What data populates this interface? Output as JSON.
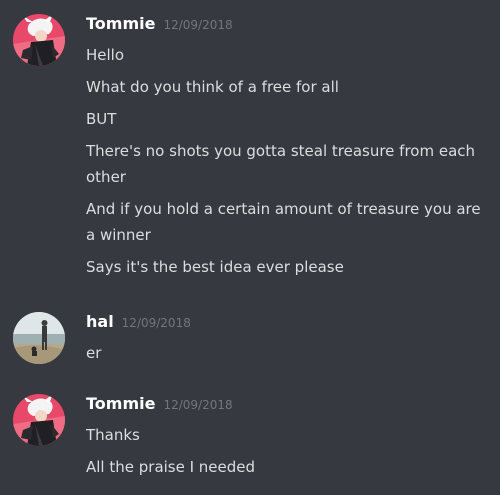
{
  "messages": [
    {
      "username": "Tommie",
      "timestamp": "12/09/2018",
      "avatar_icon": "anime-character-avatar",
      "lines": [
        "Hello",
        "What do you think of a free for all",
        "BUT",
        "There's no shots you gotta steal treasure from each other",
        "And if you hold a certain amount of treasure you are a winner",
        "Says it's the best idea ever please"
      ]
    },
    {
      "username": "hal",
      "timestamp": "12/09/2018",
      "avatar_icon": "beach-photo-avatar",
      "lines": [
        "er"
      ]
    },
    {
      "username": "Tommie",
      "timestamp": "12/09/2018",
      "avatar_icon": "anime-character-avatar",
      "lines": [
        "Thanks",
        "All the praise I needed"
      ]
    }
  ],
  "colors": {
    "background": "#36393f",
    "username": "#ffffff",
    "timestamp": "#72767d",
    "text": "#dcddde"
  }
}
